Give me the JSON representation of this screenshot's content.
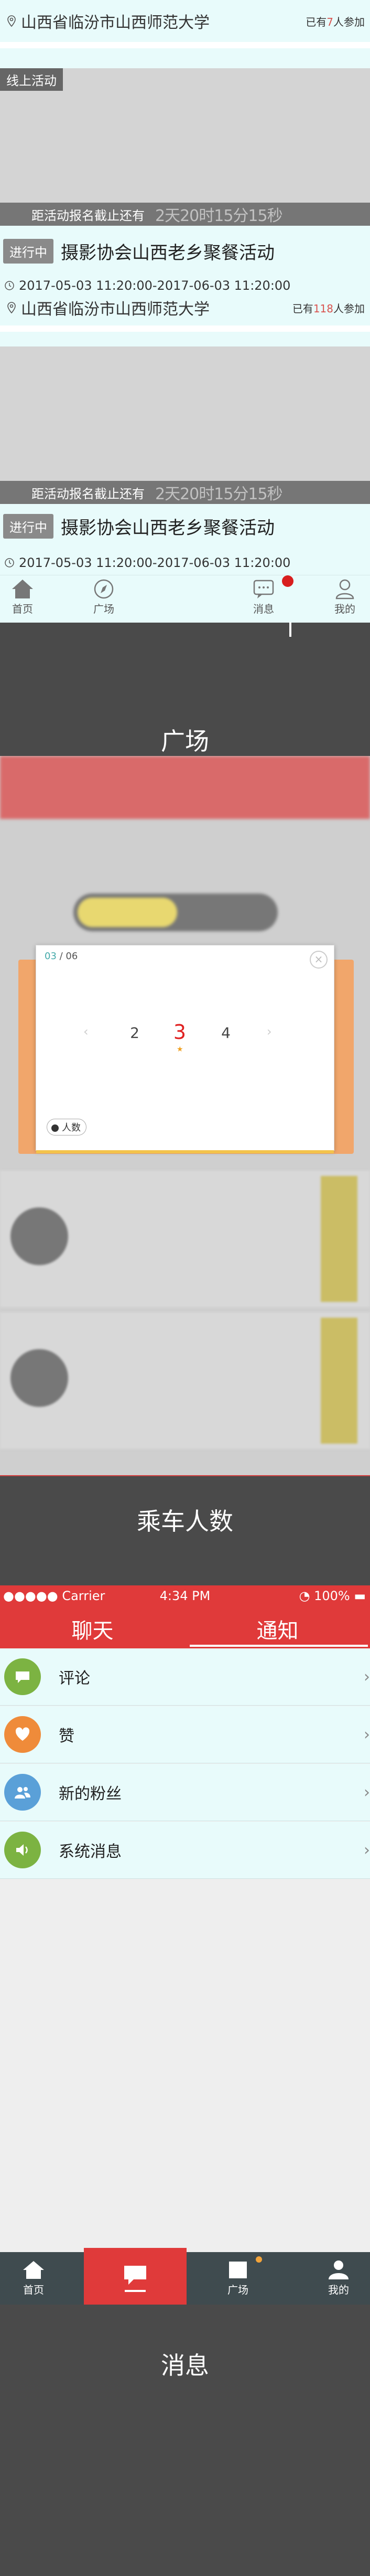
{
  "feed": {
    "header_location": {
      "text": "山西省临汾市山西师范大学",
      "joined_prefix": "已有",
      "joined_count": "7",
      "joined_suffix": "人参加"
    },
    "events": [
      {
        "tag": "线上活动",
        "deadline_label": "距活动报名截止还有",
        "deadline_value": "2天20时15分15秒",
        "status": "进行中",
        "title": "摄影协会山西老乡聚餐活动",
        "time_range": "2017-05-03 11:20:00-2017-06-03 11:20:00",
        "location": "山西省临汾市山西师范大学",
        "joined_prefix": "已有",
        "joined_count": "118",
        "joined_suffix": "人参加"
      },
      {
        "deadline_label": "距活动报名截止还有",
        "deadline_value": "2天20时15分15秒",
        "status": "进行中",
        "title": "摄影协会山西老乡聚餐活动",
        "time_range": "2017-05-03 11:20:00-2017-06-03 11:20:00"
      }
    ],
    "tabbar": {
      "home": "首页",
      "square": "广场",
      "messages": "消息",
      "mine": "我的"
    }
  },
  "captions": {
    "first": "广场",
    "second": "乘车人数",
    "third": "消息"
  },
  "picker": {
    "page_current": "03",
    "page_total": "06",
    "numbers": [
      "2",
      "3",
      "4"
    ],
    "selected": "3",
    "people_label": "人数",
    "close_icon": "close-icon",
    "chevron_left": "‹",
    "chevron_right": "›"
  },
  "messages_screen": {
    "statusbar": {
      "carrier": "●●●●● Carrier ",
      "time": "4:34 PM",
      "battery": "100%"
    },
    "tabs": {
      "chat": "聊天",
      "notify": "通知"
    },
    "rows": [
      {
        "label": "评论",
        "color": "#7cb342"
      },
      {
        "label": "赞",
        "color": "#ef8b3a"
      },
      {
        "label": "新的粉丝",
        "color": "#5aa0d8"
      },
      {
        "label": "系统消息",
        "color": "#7cb342"
      }
    ],
    "tabbar": {
      "home": "首页",
      "square": "广场",
      "mine": "我的"
    }
  }
}
